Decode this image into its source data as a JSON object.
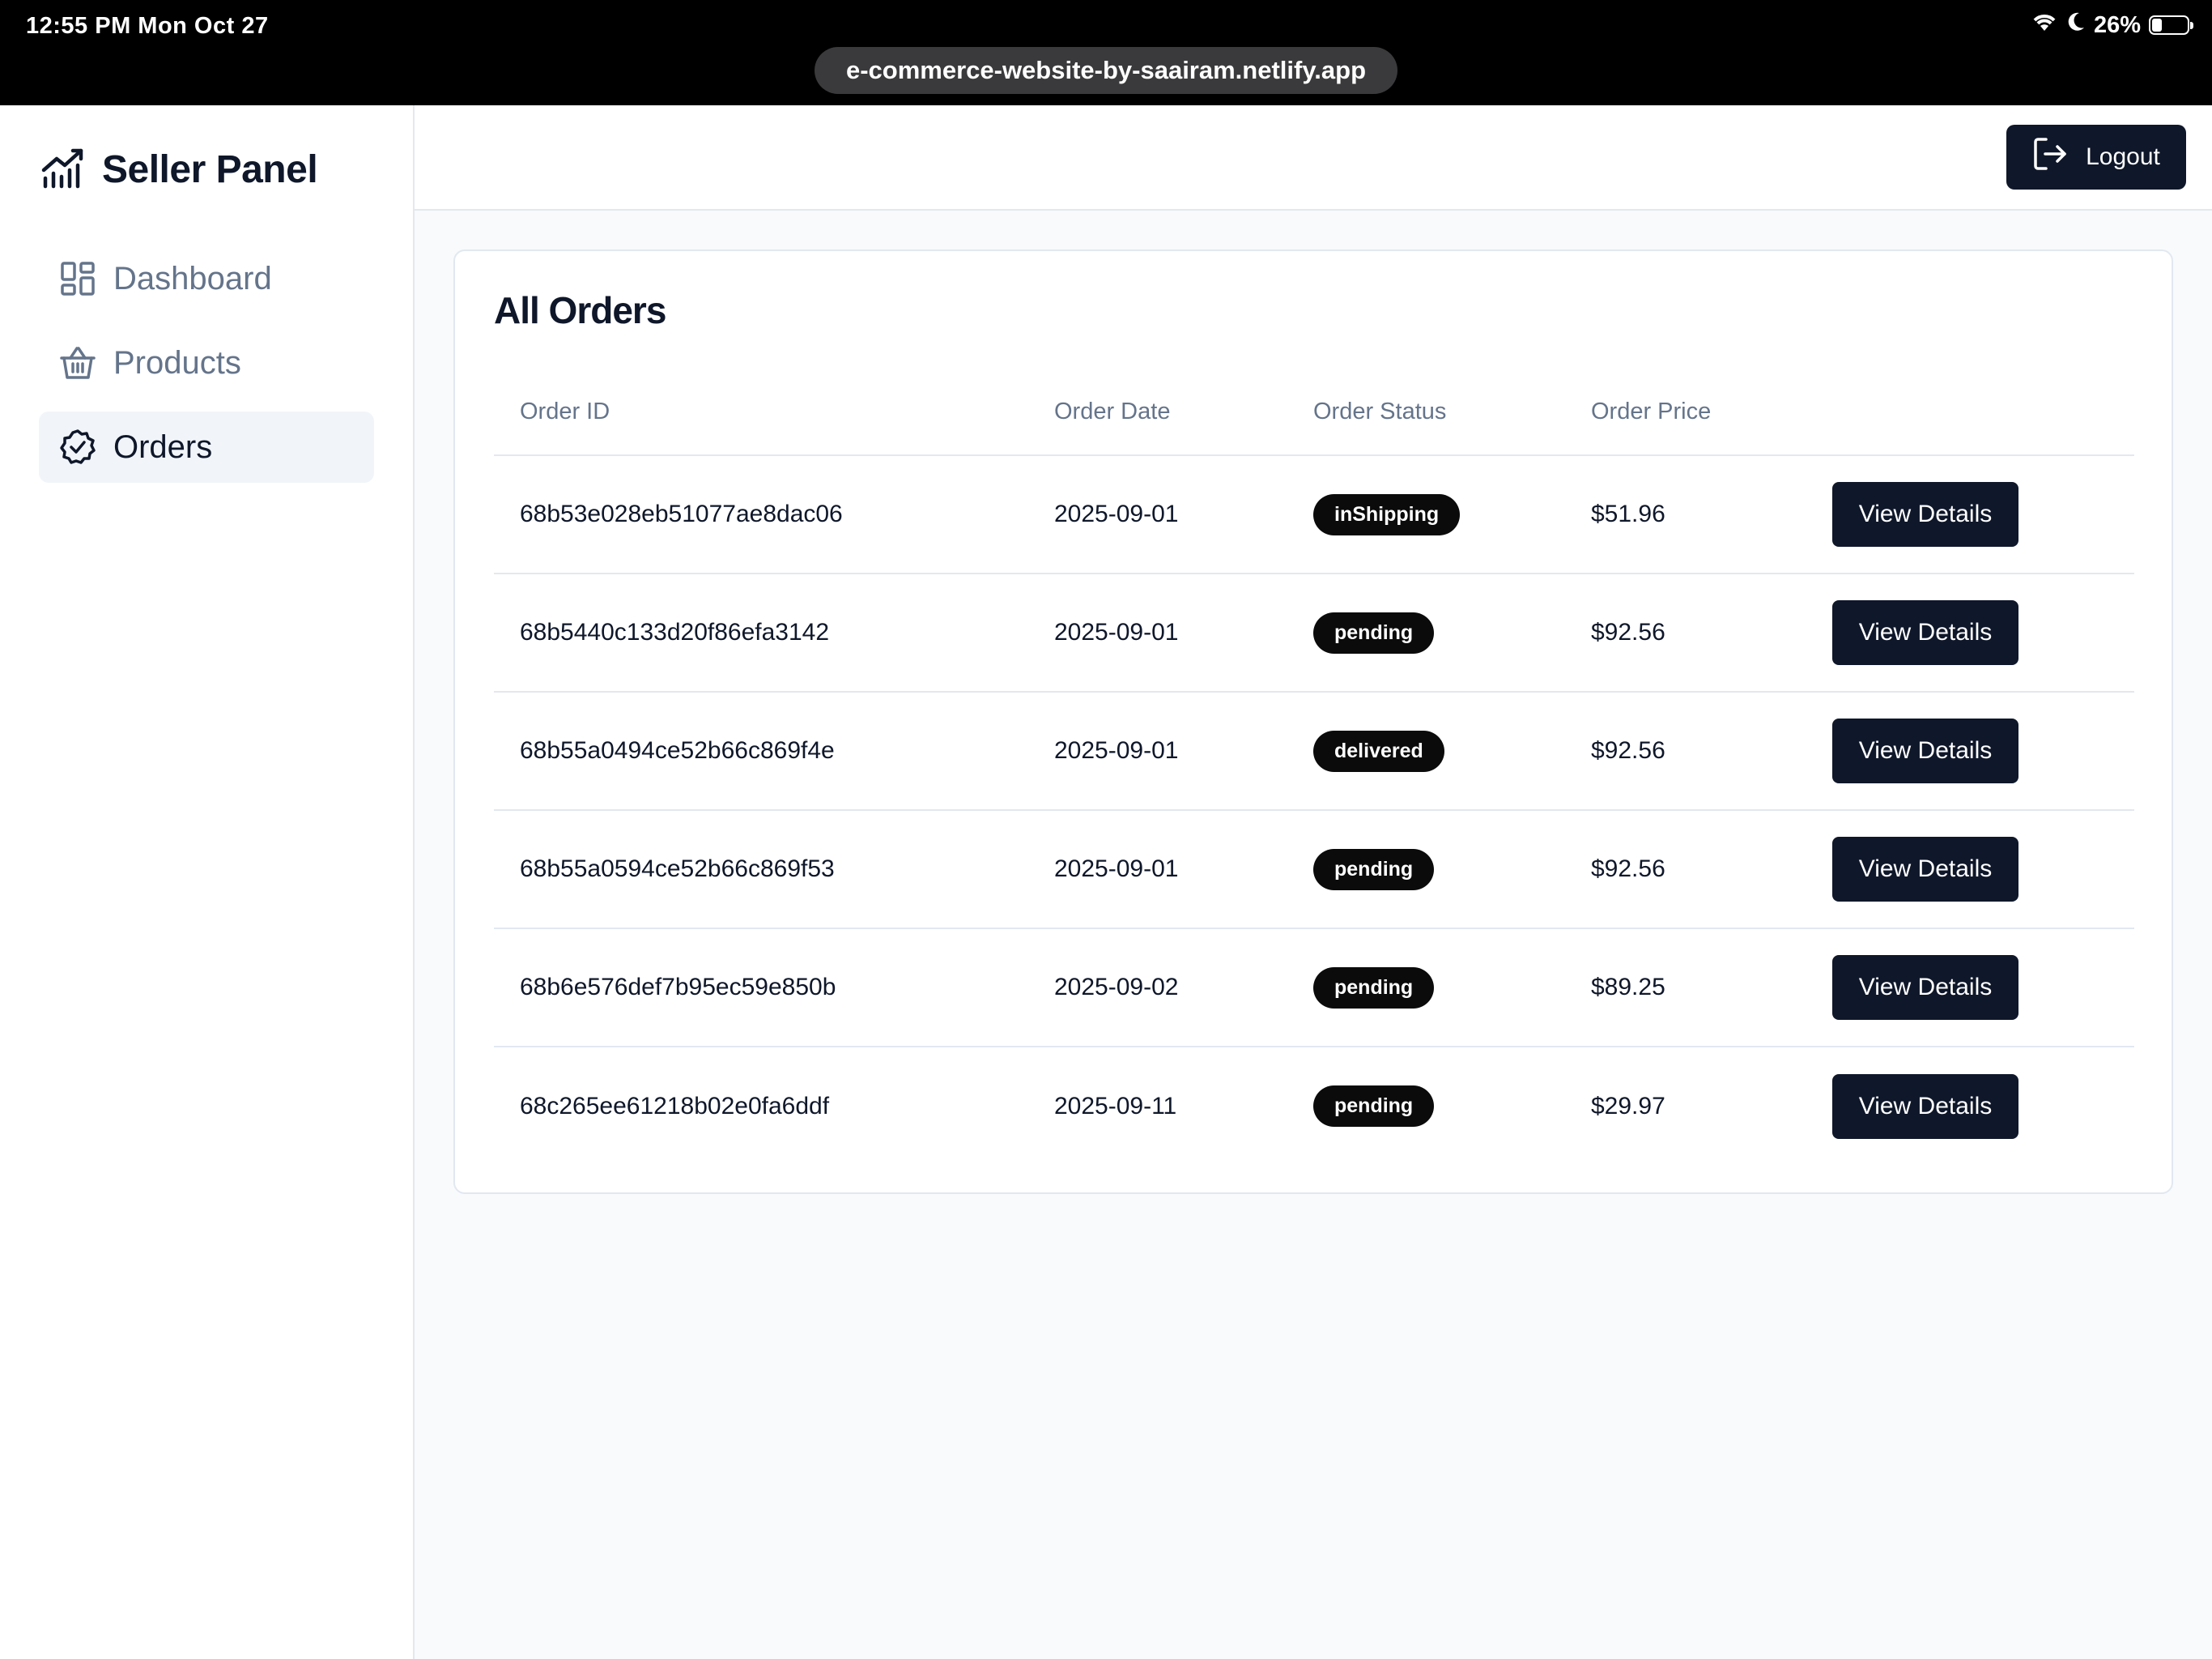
{
  "status_bar": {
    "time": "12:55 PM  Mon Oct 27",
    "battery_text": "26%",
    "battery_level": 0.26,
    "url": "e-commerce-website-by-saairam.netlify.app"
  },
  "sidebar": {
    "brand": "Seller Panel",
    "items": [
      {
        "label": "Dashboard",
        "icon": "dashboard-grid-icon",
        "active": false
      },
      {
        "label": "Products",
        "icon": "basket-icon",
        "active": false
      },
      {
        "label": "Orders",
        "icon": "check-badge-icon",
        "active": true
      }
    ]
  },
  "header": {
    "logout_label": "Logout"
  },
  "orders": {
    "title": "All Orders",
    "columns": [
      "Order ID",
      "Order Date",
      "Order Status",
      "Order Price",
      ""
    ],
    "action_label": "View Details",
    "rows": [
      {
        "id": "68b53e028eb51077ae8dac06",
        "date": "2025-09-01",
        "status": "inShipping",
        "price": "$51.96"
      },
      {
        "id": "68b5440c133d20f86efa3142",
        "date": "2025-09-01",
        "status": "pending",
        "price": "$92.56"
      },
      {
        "id": "68b55a0494ce52b66c869f4e",
        "date": "2025-09-01",
        "status": "delivered",
        "price": "$92.56"
      },
      {
        "id": "68b55a0594ce52b66c869f53",
        "date": "2025-09-01",
        "status": "pending",
        "price": "$92.56"
      },
      {
        "id": "68b6e576def7b95ec59e850b",
        "date": "2025-09-02",
        "status": "pending",
        "price": "$89.25"
      },
      {
        "id": "68c265ee61218b02e0fa6ddf",
        "date": "2025-09-11",
        "status": "pending",
        "price": "$29.97"
      }
    ]
  },
  "colors": {
    "primary": "#0f172a",
    "muted": "#64748b",
    "border": "#e2e8f0",
    "page_bg": "#f8fafc"
  }
}
